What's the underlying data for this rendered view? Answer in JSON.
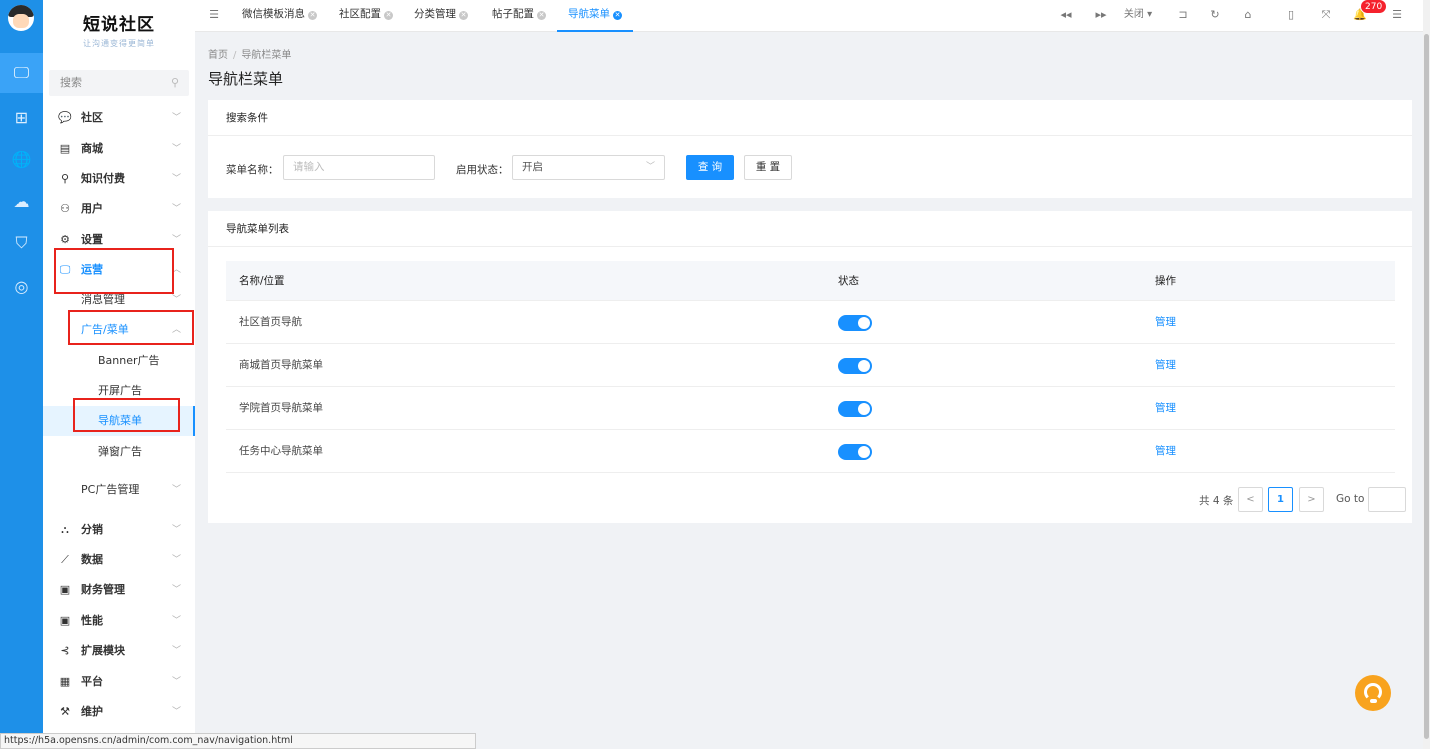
{
  "rail": {
    "items": [
      {
        "name": "monitor-icon",
        "glyph": "🖵"
      },
      {
        "name": "grid-icon",
        "glyph": "⊞"
      },
      {
        "name": "globe-icon",
        "glyph": "🌐"
      },
      {
        "name": "cloud-icon",
        "glyph": "☁"
      },
      {
        "name": "shield-icon",
        "glyph": "⛉"
      },
      {
        "name": "headset-icon",
        "glyph": "◎"
      }
    ]
  },
  "logo": {
    "name": "短说社区",
    "sub": "让沟通变得更简单"
  },
  "sidebar": {
    "search_placeholder": "搜索",
    "search_icon": "⚲",
    "menu": [
      {
        "label": "社区",
        "icon": "💬"
      },
      {
        "label": "商城",
        "icon": "▤"
      },
      {
        "label": "知识付费",
        "icon": "⚲"
      },
      {
        "label": "用户",
        "icon": "⚇"
      },
      {
        "label": "设置",
        "icon": "⚙"
      },
      {
        "label": "运营",
        "icon": "🖵"
      },
      {
        "label": "分销",
        "icon": "⛬"
      },
      {
        "label": "数据",
        "icon": "⟋"
      },
      {
        "label": "财务管理",
        "icon": "▣"
      },
      {
        "label": "性能",
        "icon": "▣"
      },
      {
        "label": "扩展模块",
        "icon": "⊰"
      },
      {
        "label": "平台",
        "icon": "▦"
      },
      {
        "label": "维护",
        "icon": "⚒"
      }
    ],
    "ops_sub": {
      "msg": "消息管理",
      "ad_menu": "广告/菜单",
      "banner": "Banner广告",
      "splash": "开屏广告",
      "nav": "导航菜单",
      "popup": "弹窗广告",
      "pc_ad": "PC广告管理"
    }
  },
  "topbar": {
    "menu_icon": "☰",
    "tabs": [
      "微信模板消息",
      "社区配置",
      "分类管理",
      "帖子配置",
      "导航菜单"
    ],
    "close_label": "关闭",
    "badge": "270"
  },
  "breadcrumb": {
    "home": "首页",
    "sep": "/",
    "current": "导航栏菜单"
  },
  "page_title": "导航栏菜单",
  "search": {
    "title": "搜索条件",
    "name_label": "菜单名称：",
    "name_placeholder": "请输入",
    "status_label": "启用状态：",
    "status_value": "开启",
    "query_btn": "查 询",
    "reset_btn": "重 置"
  },
  "list": {
    "title": "导航菜单列表",
    "columns": [
      "名称/位置",
      "状态",
      "操作"
    ],
    "rows": [
      {
        "name": "社区首页导航",
        "enabled": true,
        "action": "管理"
      },
      {
        "name": "商城首页导航菜单",
        "enabled": true,
        "action": "管理"
      },
      {
        "name": "学院首页导航菜单",
        "enabled": true,
        "action": "管理"
      },
      {
        "name": "任务中心导航菜单",
        "enabled": true,
        "action": "管理"
      }
    ]
  },
  "pager": {
    "total": "共 4 条",
    "prev": "<",
    "page": "1",
    "next": ">",
    "goto": "Go to"
  },
  "statusbar": "https://h5a.opensns.cn/admin/com.com_nav/navigation.html",
  "colors": {
    "accent": "#1890ff",
    "rail": "#1e90e8",
    "highlight": "#e8231c",
    "help": "#f8a31e"
  }
}
